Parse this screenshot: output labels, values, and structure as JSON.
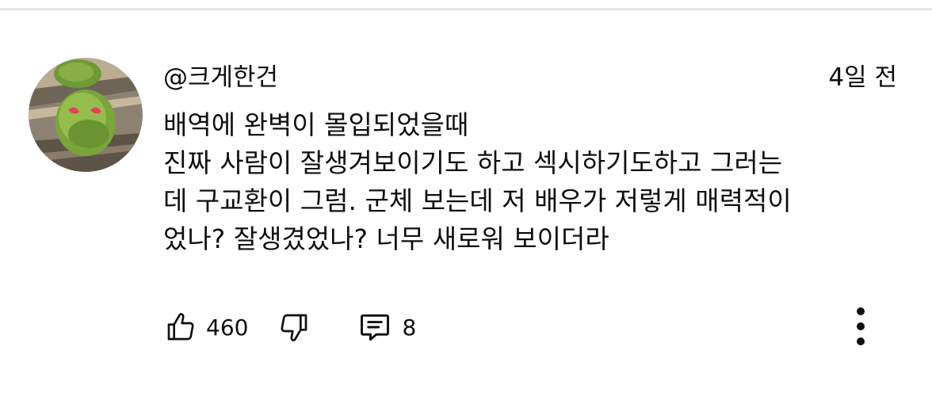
{
  "comment": {
    "author": "@크게한건",
    "timestamp": "4일 전",
    "lines": [
      "배역에 완벽이 몰입되었을때",
      "진짜 사람이 잘생겨보이기도 하고 섹시하기도하고 그러는",
      "데 구교환이 그럼. 군체 보는데 저 배우가 저렇게 매력적이",
      "었나? 잘생겼었나? 너무 새로워 보이더라"
    ],
    "like_count": "460",
    "reply_count": "8"
  },
  "icons": {
    "like": "thumbs-up-icon",
    "dislike": "thumbs-down-icon",
    "reply": "comment-icon",
    "more": "more-vertical-icon"
  },
  "colors": {
    "text": "#0f0f0f",
    "icon": "#0f0f0f",
    "divider": "#e5e5e5"
  }
}
